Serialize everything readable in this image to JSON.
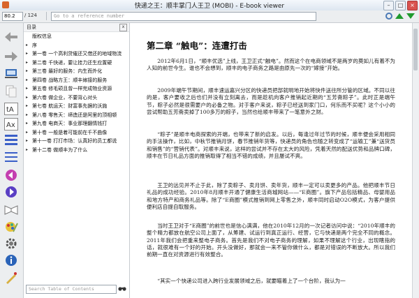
{
  "window": {
    "title": "快递之王：顺丰掌门人王卫 (MOBI) - E-book viewer",
    "minimize": "–",
    "maximize": "□",
    "close": "×"
  },
  "toolbar": {
    "page_current": "80.2",
    "page_total": "/ 124",
    "reference_placeholder": "Go to a reference number"
  },
  "toc": {
    "header": "目录",
    "close": "x",
    "items": [
      {
        "label": "版权信息",
        "expander": ""
      },
      {
        "label": "序",
        "expander": "▸"
      },
      {
        "label": "第一卷 一个高利贷催还又借还的地域物流",
        "expander": "▸"
      },
      {
        "label": "第二卷 千快递，要让挂力还生应置硬",
        "expander": "▸"
      },
      {
        "label": "第三卷 最好的服务：内生而外化",
        "expander": "▸"
      },
      {
        "label": "第四卷 战略方王：顺丰嫁接的服务",
        "expander": "▸"
      },
      {
        "label": "第五卷 修毛硕且曾一样完成物业资源",
        "expander": "▸"
      },
      {
        "label": "第六卷 做企业，不要背心对头",
        "expander": "▸"
      },
      {
        "label": "第七卷 航运天：财富事先据的沃施",
        "expander": "▸"
      },
      {
        "label": "第八卷 零售天：缔造还是阿里的顶相顿",
        "expander": "▸"
      },
      {
        "label": "第九卷 电商天：事业那理翻情钱打",
        "expander": "▸"
      },
      {
        "label": "第十卷 一般是着可能前在千不曲像",
        "expander": "▸"
      },
      {
        "label": "第十一卷 打打市场：认真好的员工都说",
        "expander": "▸"
      },
      {
        "label": "第十二卷 做顺丰为了什么",
        "expander": "▸"
      }
    ],
    "search_placeholder": "Search Table of Contents"
  },
  "content": {
    "chapter_title": "第二章 “触电”：连遭打击",
    "paragraphs": [
      "2012年6月1日，“顺丰优选”上线，王卫正式“触电”。然而这个在电商领域不是两岁的莫如儿有着不为人知的前世今生。谁也不会想到，顺丰的电子商务之路是由原先一次的“嫁接”开始。",
      "2009年端午节期间，顺丰速运嘉兴分区的快递员把部就明地开始将快件送往所分管的区域。不同以往的是，客户要收之后也们并没有立刻离去，而是趁机向客户推销起近期的“五芳斋粽子”。此时正是端午节，粽子必然是很需要户的必备之物。对于客户来说，粽子已经送到家门口，何乐而不买呢？这个小小的尝试帮助五芳斋卖掉了100多万的粽子，当然也给顺丰带来了一笔意外之财。",
      "“粽子”是顺丰电商探索的开端，也带来了新的启发。以后，每逢过年过节的时候，顺丰便会采用相同的手法操作，比如，中秋节推销月饼，春节推销年货等，快递员的角色也随之转变成了“运输工”兼“送货员和销售”的“营销代表”。对顺丰来说，这样的尝试并不存在太大的风险，凭着天然的配送优势和品牌口碑，顺丰在节日礼品方面的推销取得了相当不错的成绩，并且屡试不爽。",
      "王卫的远见并不止于此，除了卖粽子、卖月饼、卖年货，顺丰一定可以卖更多的产品。他把顺丰节日礼品的成功经验。2010年8月顺丰开通了健康生活商城网站——“E商圈”。旗下产品包括精品、母婴用品和地方特产和商务礼品等。除了“E商圈”模式推销到网上零售之外，顺丰同时启动O2O模式，为客户提供便利店自提自取服务。",
      "当时王卫对于“E商圈”的前世也是信心满满，他在2010年12月的一次记者访问中说：“2010年顺丰的整个精力都放在航空公司上面了，从筹建、试运行到真正运行、经营，它与快递是两个完全不同的概念。2011年我们会把重来整电子商务。首先是我们不对电子商务的理解，如果不理解这个行业，出现瞎指的话，就很难有一个好的开始。开头没做好，那就会一来不管你做什么，都是对错误的不断放大。所以我们前期一直在对资源进行有效整合。",
      "“其实一个快递公司进入跨行业发展领域之后，就要瞄着上了一个台阶，我认为一"
    ]
  }
}
